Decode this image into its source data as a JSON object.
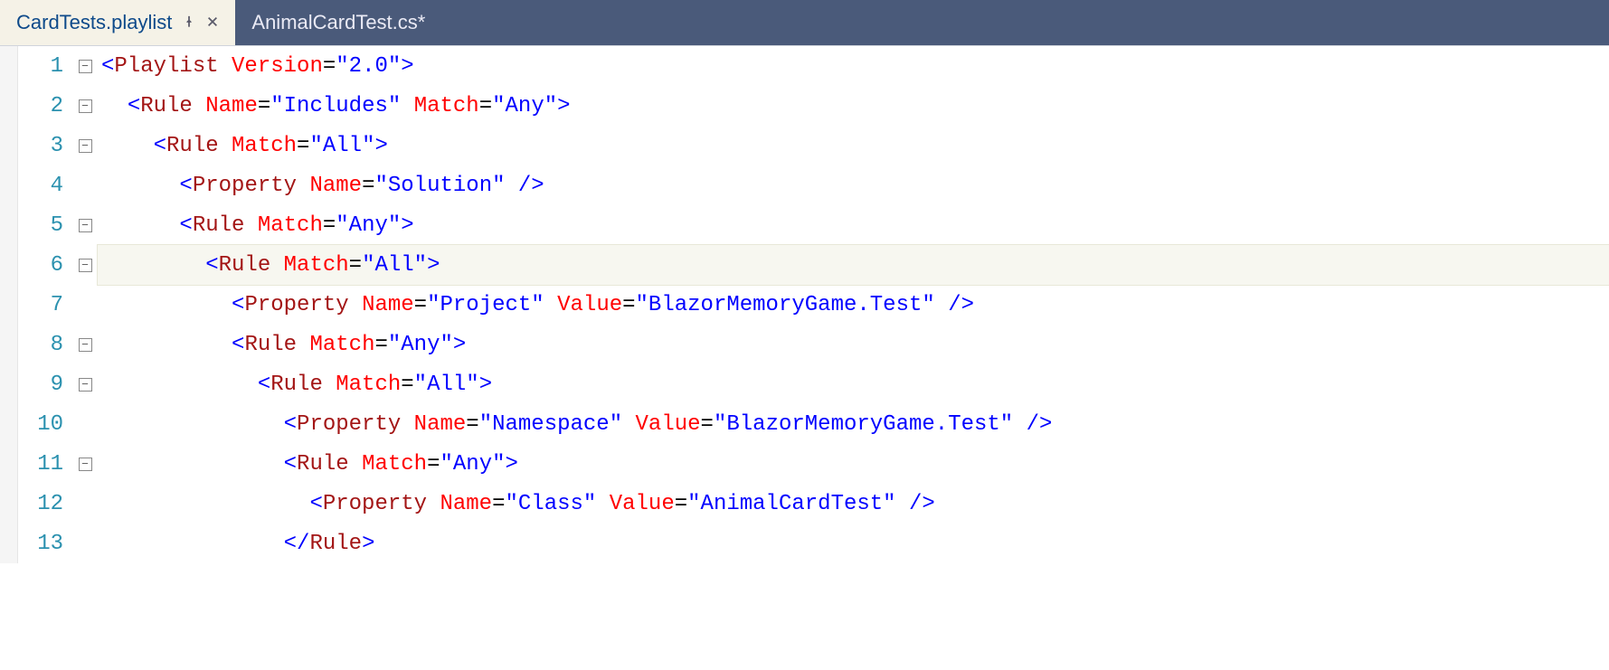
{
  "tabs": {
    "active": {
      "label": "CardTests.playlist"
    },
    "inactive": {
      "label": "AnimalCardTest.cs*"
    }
  },
  "lines": [
    {
      "num": "1",
      "fold": "minus",
      "indent": 0,
      "current": false,
      "tokens": [
        [
          "punct",
          "<"
        ],
        [
          "elem",
          "Playlist"
        ],
        [
          "plain",
          " "
        ],
        [
          "attr",
          "Version"
        ],
        [
          "eq",
          "="
        ],
        [
          "str",
          "\"2.0\""
        ],
        [
          "punct",
          ">"
        ]
      ]
    },
    {
      "num": "2",
      "fold": "minus",
      "indent": 1,
      "current": false,
      "tokens": [
        [
          "punct",
          "<"
        ],
        [
          "elem",
          "Rule"
        ],
        [
          "plain",
          " "
        ],
        [
          "attr",
          "Name"
        ],
        [
          "eq",
          "="
        ],
        [
          "str",
          "\"Includes\""
        ],
        [
          "plain",
          " "
        ],
        [
          "attr",
          "Match"
        ],
        [
          "eq",
          "="
        ],
        [
          "str",
          "\"Any\""
        ],
        [
          "punct",
          ">"
        ]
      ]
    },
    {
      "num": "3",
      "fold": "minus",
      "indent": 2,
      "current": false,
      "tokens": [
        [
          "punct",
          "<"
        ],
        [
          "elem",
          "Rule"
        ],
        [
          "plain",
          " "
        ],
        [
          "attr",
          "Match"
        ],
        [
          "eq",
          "="
        ],
        [
          "str",
          "\"All\""
        ],
        [
          "punct",
          ">"
        ]
      ]
    },
    {
      "num": "4",
      "fold": "line",
      "indent": 3,
      "current": false,
      "tokens": [
        [
          "punct",
          "<"
        ],
        [
          "elem",
          "Property"
        ],
        [
          "plain",
          " "
        ],
        [
          "attr",
          "Name"
        ],
        [
          "eq",
          "="
        ],
        [
          "str",
          "\"Solution\""
        ],
        [
          "plain",
          " "
        ],
        [
          "punct",
          "/>"
        ]
      ]
    },
    {
      "num": "5",
      "fold": "minus",
      "indent": 3,
      "current": false,
      "tokens": [
        [
          "punct",
          "<"
        ],
        [
          "elem",
          "Rule"
        ],
        [
          "plain",
          " "
        ],
        [
          "attr",
          "Match"
        ],
        [
          "eq",
          "="
        ],
        [
          "str",
          "\"Any\""
        ],
        [
          "punct",
          ">"
        ]
      ]
    },
    {
      "num": "6",
      "fold": "minus",
      "indent": 4,
      "current": true,
      "tokens": [
        [
          "punct",
          "<"
        ],
        [
          "elem",
          "Rule"
        ],
        [
          "plain",
          " "
        ],
        [
          "attr",
          "Match"
        ],
        [
          "eq",
          "="
        ],
        [
          "str",
          "\"All\""
        ],
        [
          "punct",
          ">"
        ]
      ]
    },
    {
      "num": "7",
      "fold": "line",
      "indent": 5,
      "current": false,
      "tokens": [
        [
          "punct",
          "<"
        ],
        [
          "elem",
          "Property"
        ],
        [
          "plain",
          " "
        ],
        [
          "attr",
          "Name"
        ],
        [
          "eq",
          "="
        ],
        [
          "str",
          "\"Project\""
        ],
        [
          "plain",
          " "
        ],
        [
          "attr",
          "Value"
        ],
        [
          "eq",
          "="
        ],
        [
          "str",
          "\"BlazorMemoryGame.Test\""
        ],
        [
          "plain",
          " "
        ],
        [
          "punct",
          "/>"
        ]
      ]
    },
    {
      "num": "8",
      "fold": "minus",
      "indent": 5,
      "current": false,
      "tokens": [
        [
          "punct",
          "<"
        ],
        [
          "elem",
          "Rule"
        ],
        [
          "plain",
          " "
        ],
        [
          "attr",
          "Match"
        ],
        [
          "eq",
          "="
        ],
        [
          "str",
          "\"Any\""
        ],
        [
          "punct",
          ">"
        ]
      ]
    },
    {
      "num": "9",
      "fold": "minus",
      "indent": 6,
      "current": false,
      "tokens": [
        [
          "punct",
          "<"
        ],
        [
          "elem",
          "Rule"
        ],
        [
          "plain",
          " "
        ],
        [
          "attr",
          "Match"
        ],
        [
          "eq",
          "="
        ],
        [
          "str",
          "\"All\""
        ],
        [
          "punct",
          ">"
        ]
      ]
    },
    {
      "num": "10",
      "fold": "line",
      "indent": 7,
      "current": false,
      "tokens": [
        [
          "punct",
          "<"
        ],
        [
          "elem",
          "Property"
        ],
        [
          "plain",
          " "
        ],
        [
          "attr",
          "Name"
        ],
        [
          "eq",
          "="
        ],
        [
          "str",
          "\"Namespace\""
        ],
        [
          "plain",
          " "
        ],
        [
          "attr",
          "Value"
        ],
        [
          "eq",
          "="
        ],
        [
          "str",
          "\"BlazorMemoryGame.Test\""
        ],
        [
          "plain",
          " "
        ],
        [
          "punct",
          "/>"
        ]
      ]
    },
    {
      "num": "11",
      "fold": "minus",
      "indent": 7,
      "current": false,
      "tokens": [
        [
          "punct",
          "<"
        ],
        [
          "elem",
          "Rule"
        ],
        [
          "plain",
          " "
        ],
        [
          "attr",
          "Match"
        ],
        [
          "eq",
          "="
        ],
        [
          "str",
          "\"Any\""
        ],
        [
          "punct",
          ">"
        ]
      ]
    },
    {
      "num": "12",
      "fold": "line",
      "indent": 8,
      "current": false,
      "tokens": [
        [
          "punct",
          "<"
        ],
        [
          "elem",
          "Property"
        ],
        [
          "plain",
          " "
        ],
        [
          "attr",
          "Name"
        ],
        [
          "eq",
          "="
        ],
        [
          "str",
          "\"Class\""
        ],
        [
          "plain",
          " "
        ],
        [
          "attr",
          "Value"
        ],
        [
          "eq",
          "="
        ],
        [
          "str",
          "\"AnimalCardTest\""
        ],
        [
          "plain",
          " "
        ],
        [
          "punct",
          "/>"
        ]
      ]
    },
    {
      "num": "13",
      "fold": "line",
      "indent": 7,
      "current": false,
      "tokens": [
        [
          "punct",
          "</"
        ],
        [
          "elem",
          "Rule"
        ],
        [
          "punct",
          ">"
        ]
      ]
    }
  ]
}
